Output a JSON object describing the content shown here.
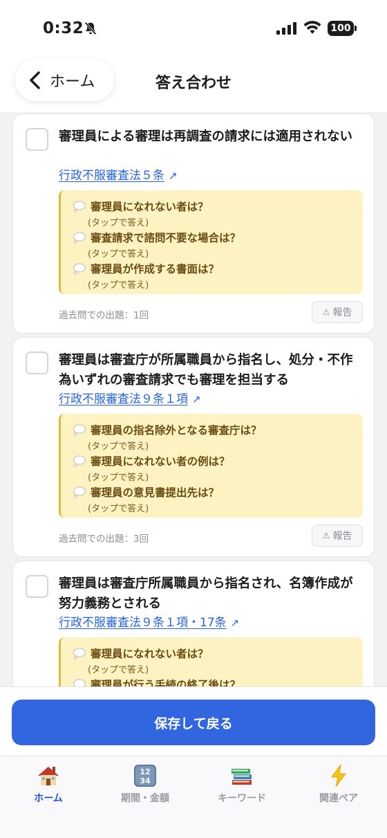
{
  "status": {
    "time": "0:32",
    "battery": "100"
  },
  "nav": {
    "back_label": "ホーム",
    "title": "答え合わせ"
  },
  "cards": [
    {
      "question": "審理員による審理は再調査の請求には適用されない",
      "law": "行政不服審査法５条",
      "hints": [
        {
          "q": "審理員になれない者は？",
          "sub": "(タップで答え)"
        },
        {
          "q": "審査請求で諮問不要な場合は？",
          "sub": "(タップで答え)"
        },
        {
          "q": "審理員が作成する書面は？",
          "sub": "(タップで答え)"
        }
      ],
      "past": "過去問での出題：1回",
      "report": "報告"
    },
    {
      "question": "審理員は審査庁が所属職員から指名し、処分・不作為いずれの審査請求でも審理を担当する",
      "law": "行政不服審査法９条１項",
      "hints": [
        {
          "q": "審理員の指名除外となる審査庁は？",
          "sub": "(タップで答え)"
        },
        {
          "q": "審理員になれない者の例は？",
          "sub": "(タップで答え)"
        },
        {
          "q": "審理員の意見書提出先は？",
          "sub": "(タップで答え)"
        }
      ],
      "past": "過去問での出題：3回",
      "report": "報告"
    },
    {
      "question": "審理員は審査庁所属職員から指名され、名簿作成が努力義務とされる",
      "law": "行政不服審査法９条１項・17条",
      "hints": [
        {
          "q": "審理員になれない者は？",
          "sub": "(タップで答え)"
        },
        {
          "q": "審理員が行う手続の終了後は？",
          "sub": ""
        }
      ]
    }
  ],
  "save_label": "保存して戻る",
  "tabs": [
    {
      "label": "ホーム",
      "icon": "house-icon"
    },
    {
      "label": "期間・金額",
      "icon": "numbers-icon"
    },
    {
      "label": "キーワード",
      "icon": "books-icon"
    },
    {
      "label": "関連ペア",
      "icon": "lightning-icon"
    }
  ],
  "colors": {
    "accent": "#3166e0",
    "link": "#2563eb",
    "hint_bg": "#fdf3c2",
    "active_tab": "#1e56d6"
  }
}
